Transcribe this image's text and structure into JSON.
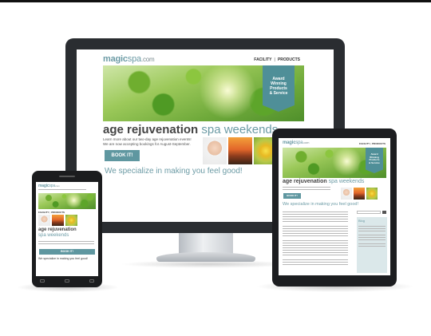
{
  "brand": {
    "logo_bold": "magic",
    "logo_light": "spa",
    "logo_suffix": ".com"
  },
  "nav": {
    "facility": "FACILITY",
    "products": "PRODUCTS"
  },
  "award": {
    "line1": "Award",
    "line2": "Winning",
    "line3": "Products",
    "line4": "& Service"
  },
  "hero": {
    "headline_bold": "age rejuvenation",
    "headline_light": "spa weekends",
    "intro_line1": "Learn more about our two-day age rejuvenation events!",
    "intro_line2": "We are now accepting bookings for August-September.",
    "book_label": "BOOK IT!",
    "tagline": "We specialize in making you feel good!"
  },
  "tablet": {
    "headline_bold": "age rejuvenation",
    "headline_light": "spa weekends",
    "book_label": "BOOK IT!",
    "tagline": "We specialize in making you feel good!",
    "sidebar_title": "Blog"
  },
  "phone": {
    "headline_bold": "age rejuvenation",
    "headline_light": "spa weekends",
    "book_label": "BOOK IT!",
    "tagline": "We specialize in making you feel good!",
    "nav_facility": "FACILITY",
    "nav_products": "PRODUCTS"
  },
  "colors": {
    "accent": "#6c9ba5",
    "button": "#5f97a0",
    "device": "#1c1d20"
  }
}
